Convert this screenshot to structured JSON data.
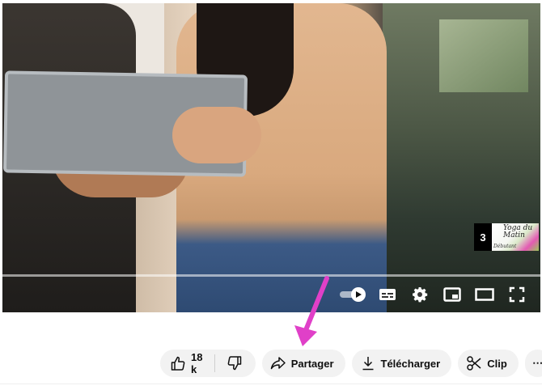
{
  "player": {
    "endscreen": {
      "count": "3",
      "thumb_title": "Yoga du Matin",
      "thumb_sub": "Débutant"
    },
    "controls": [
      {
        "name": "autoplay-toggle",
        "icon": "autoplay-icon"
      },
      {
        "name": "subtitles-button",
        "icon": "subtitles-icon"
      },
      {
        "name": "settings-button",
        "icon": "gear-icon"
      },
      {
        "name": "miniplayer-button",
        "icon": "miniplayer-icon"
      },
      {
        "name": "theater-mode-button",
        "icon": "theater-icon"
      },
      {
        "name": "fullscreen-button",
        "icon": "fullscreen-icon"
      }
    ],
    "arrow_color": "#e040c8"
  },
  "actions": {
    "like_count": "18 k",
    "share_label": "Partager",
    "download_label": "Télécharger",
    "clip_label": "Clip",
    "more_label": "⋯"
  }
}
